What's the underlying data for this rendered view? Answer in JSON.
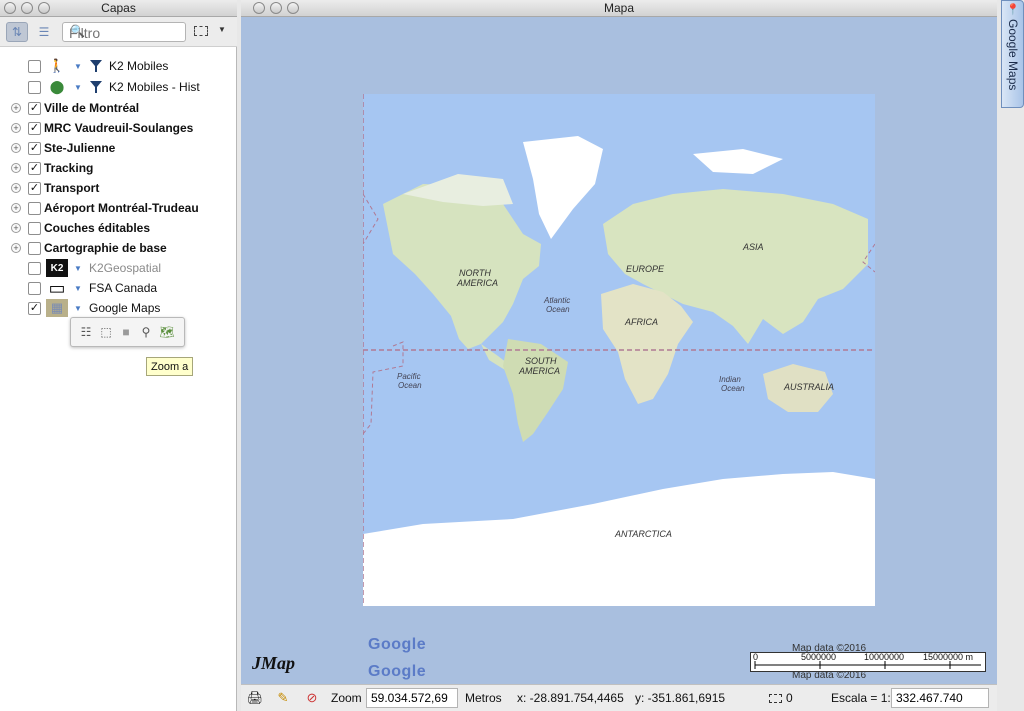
{
  "layers_window": {
    "title": "Capas",
    "filter_placeholder": "Filtro",
    "layers": [
      {
        "label": "K2 Mobiles",
        "checked": false,
        "bold": false,
        "icon": "walker-icon",
        "filter": true
      },
      {
        "label": "K2 Mobiles - Hist",
        "checked": false,
        "bold": false,
        "icon": "cluster-icon",
        "filter": true
      },
      {
        "label": "Ville de Montréal",
        "checked": true,
        "bold": true,
        "group": true
      },
      {
        "label": "MRC Vaudreuil-Soulanges",
        "checked": true,
        "bold": true,
        "group": true
      },
      {
        "label": "Ste-Julienne",
        "checked": true,
        "bold": true,
        "group": true
      },
      {
        "label": "Tracking",
        "checked": true,
        "bold": true,
        "group": true
      },
      {
        "label": "Transport",
        "checked": true,
        "bold": true,
        "group": true
      },
      {
        "label": "Aéroport Montréal-Trudeau",
        "checked": false,
        "bold": true,
        "group": true
      },
      {
        "label": "Couches éditables",
        "checked": false,
        "bold": true,
        "group": true
      },
      {
        "label": "Cartographie de base",
        "checked": false,
        "bold": true,
        "group": true
      },
      {
        "label": "K2Geospatial",
        "checked": false,
        "bold": false,
        "dimmed": true,
        "icon": "k2-logo-icon"
      },
      {
        "label": "FSA Canada",
        "checked": false,
        "bold": false,
        "icon": "polygon-icon"
      },
      {
        "label": "Google Maps",
        "checked": true,
        "bold": false,
        "icon": "map-thumb-icon"
      }
    ],
    "checkmark": "✓",
    "expander": "+",
    "tooltip": "Zoom a"
  },
  "map_window": {
    "title": "Mapa",
    "labels": {
      "north_america": "NORTH\nAMERICA",
      "south_america": "SOUTH\nAMERICA",
      "europe": "EUROPE",
      "africa": "AFRICA",
      "asia": "ASIA",
      "australia": "AUSTRALIA",
      "antarctica": "ANTARCTICA",
      "atlantic": "Atlantic\nOcean",
      "pacific": "Pacific\nOcean",
      "indian": "Indian\nOcean"
    },
    "jmap_logo": "JMap",
    "google_logo": "Google",
    "map_data": "Map data ©2016",
    "scale_ticks": [
      "0",
      "5000000",
      "10000000",
      "15000000 m"
    ]
  },
  "status_bar": {
    "zoom_label": "Zoom",
    "zoom_value": "59.034.572,69",
    "units": "Metros",
    "x_coord": "x: -28.891.754,4465",
    "y_coord": "y: -351.861,6915",
    "selection_count": "0",
    "scale_label": "Escala = 1:",
    "scale_value": "332.467.740"
  },
  "side_tab": {
    "label": "Google Maps"
  },
  "colors": {
    "ocean": "#a9bfdf",
    "land": "#d9e6c2",
    "ice": "#ffffff",
    "title_bar": "#d8d8d8"
  }
}
